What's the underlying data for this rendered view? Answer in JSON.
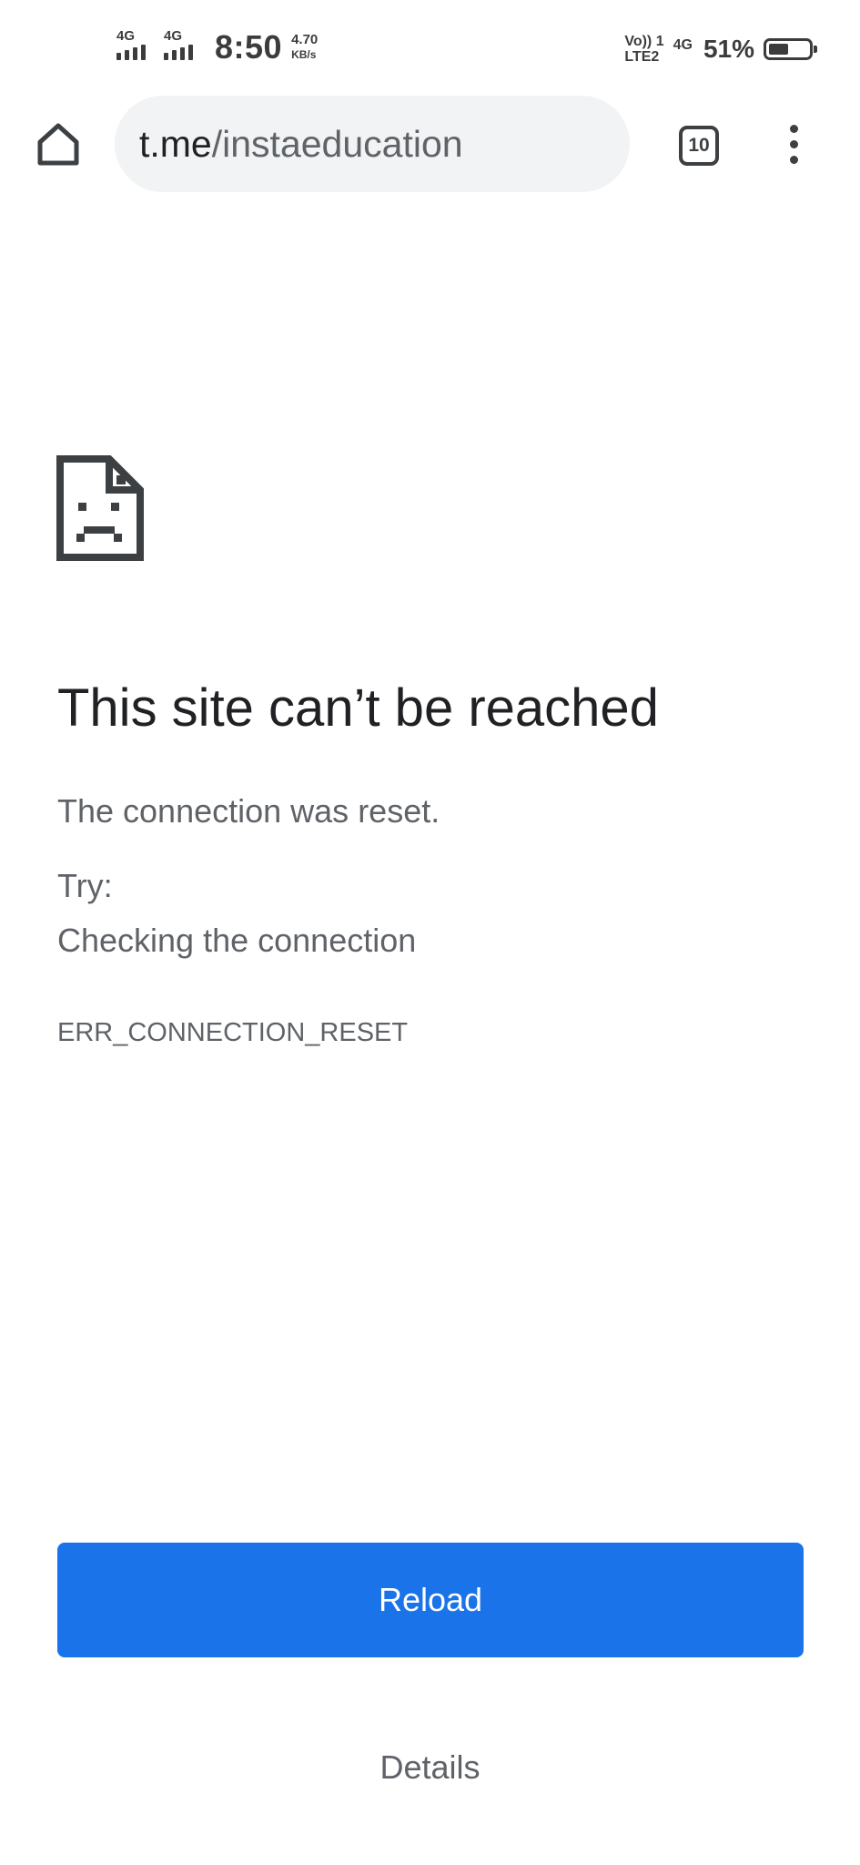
{
  "status_bar": {
    "sim1_network": "4G",
    "sim2_network": "4G",
    "time": "8:50",
    "speed_value": "4.70",
    "speed_unit": "KB/s",
    "volte_top": "Vo)) 1",
    "volte_bottom": "LTE2",
    "network_type": "4G",
    "battery_percent": "51%",
    "battery_level": 0.51
  },
  "toolbar": {
    "url_host": "t.me",
    "url_path": "/instaeducation",
    "tab_count": "10",
    "home_icon": "home-icon",
    "menu_icon": "more-vert-icon"
  },
  "error": {
    "icon": "sad-page-icon",
    "title": "This site can’t be reached",
    "description": "The connection was reset.",
    "try_label": "Try:",
    "suggestion": "Checking the connection",
    "code": "ERR_CONNECTION_RESET"
  },
  "actions": {
    "reload_label": "Reload",
    "details_label": "Details"
  },
  "colors": {
    "primary_button": "#1a73e8",
    "omnibox_background": "#f1f3f4",
    "text_primary": "#202124",
    "text_secondary": "#5f6368"
  }
}
